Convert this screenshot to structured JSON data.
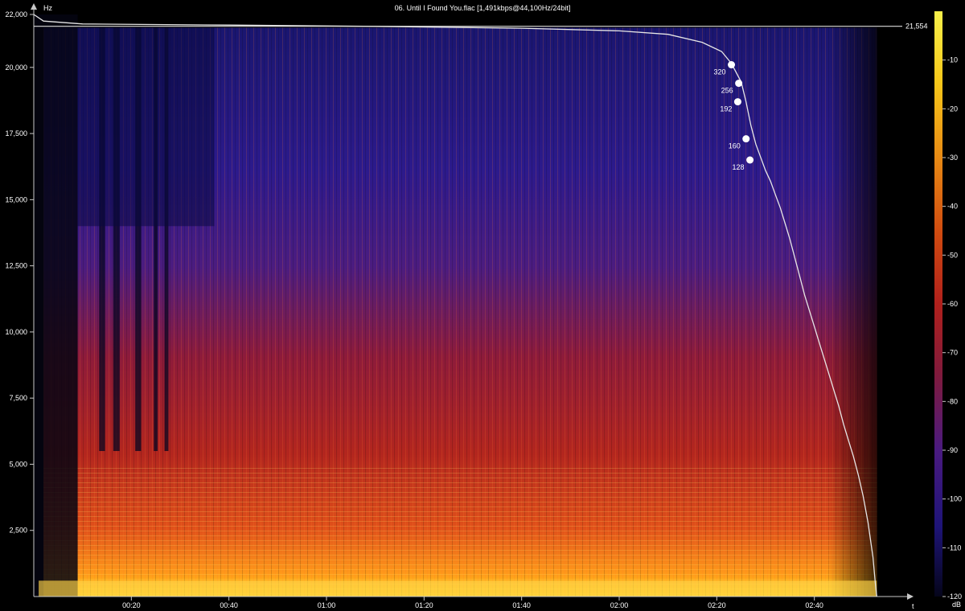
{
  "title": "06. Until I Found You.flac [1,491kbps@44,100Hz/24bit]",
  "colors": {
    "background": "#000000",
    "axis": "#c8c8c8",
    "curve": "#e6e6e6",
    "marker": "#ffffff"
  },
  "chart_data": {
    "type": "heatmap",
    "title": "06. Until I Found You.flac [1,491kbps@44,100Hz/24bit]",
    "y_unit": "Hz",
    "x_unit": "t",
    "colorbar_unit": "dB",
    "duration_s": 177,
    "ylim": [
      0,
      22000
    ],
    "y_ticks": [
      {
        "value": 2500,
        "label": "2,500"
      },
      {
        "value": 5000,
        "label": "5,000"
      },
      {
        "value": 7500,
        "label": "7,500"
      },
      {
        "value": 10000,
        "label": "10,000"
      },
      {
        "value": 12500,
        "label": "12,500"
      },
      {
        "value": 15000,
        "label": "15,000"
      },
      {
        "value": 17500,
        "label": "17,500"
      },
      {
        "value": 20000,
        "label": "20,000"
      },
      {
        "value": 22000,
        "label": "22,000"
      }
    ],
    "x_ticks": [
      {
        "value": 20,
        "label": "00:20"
      },
      {
        "value": 40,
        "label": "00:40"
      },
      {
        "value": 60,
        "label": "01:00"
      },
      {
        "value": 80,
        "label": "01:20"
      },
      {
        "value": 100,
        "label": "01:40"
      },
      {
        "value": 120,
        "label": "02:00"
      },
      {
        "value": 140,
        "label": "02:20"
      },
      {
        "value": 160,
        "label": "02:40"
      }
    ],
    "colorbar_range": [
      -120,
      0
    ],
    "colorbar_ticks": [
      {
        "value": -10,
        "label": "-10"
      },
      {
        "value": -20,
        "label": "-20"
      },
      {
        "value": -30,
        "label": "-30"
      },
      {
        "value": -40,
        "label": "-40"
      },
      {
        "value": -50,
        "label": "-50"
      },
      {
        "value": -60,
        "label": "-60"
      },
      {
        "value": -70,
        "label": "-70"
      },
      {
        "value": -80,
        "label": "-80"
      },
      {
        "value": -90,
        "label": "-90"
      },
      {
        "value": -100,
        "label": "-100"
      },
      {
        "value": -110,
        "label": "-110"
      },
      {
        "value": -120,
        "label": "-120"
      }
    ],
    "cutoff_line": {
      "value": 21554,
      "label": "21,554"
    },
    "cutoff_curve": [
      [
        0,
        22000
      ],
      [
        2,
        21750
      ],
      [
        10,
        21640
      ],
      [
        40,
        21600
      ],
      [
        70,
        21550
      ],
      [
        100,
        21480
      ],
      [
        120,
        21380
      ],
      [
        130,
        21250
      ],
      [
        137,
        20950
      ],
      [
        141,
        20600
      ],
      [
        143,
        20150
      ],
      [
        145,
        19450
      ],
      [
        146,
        18700
      ],
      [
        147,
        17800
      ],
      [
        148,
        17100
      ],
      [
        149,
        16600
      ],
      [
        150,
        16100
      ],
      [
        151,
        15700
      ],
      [
        152,
        15200
      ],
      [
        153,
        14700
      ],
      [
        154,
        14100
      ],
      [
        155,
        13500
      ],
      [
        156,
        12800
      ],
      [
        157,
        12100
      ],
      [
        158,
        11400
      ],
      [
        159,
        10800
      ],
      [
        160,
        10200
      ],
      [
        161,
        9600
      ],
      [
        162,
        9000
      ],
      [
        163,
        8400
      ],
      [
        164,
        7800
      ],
      [
        165,
        7200
      ],
      [
        166,
        6500
      ],
      [
        167,
        5900
      ],
      [
        168,
        5300
      ],
      [
        169,
        4600
      ],
      [
        170,
        3800
      ],
      [
        171,
        2800
      ],
      [
        172,
        1500
      ],
      [
        172.5,
        500
      ],
      [
        172.8,
        0
      ]
    ],
    "bitrate_markers": [
      {
        "label": "320",
        "t": 143,
        "hz": 20100
      },
      {
        "label": "256",
        "t": 144.5,
        "hz": 19400
      },
      {
        "label": "192",
        "t": 144.3,
        "hz": 18700
      },
      {
        "label": "160",
        "t": 146,
        "hz": 17300
      },
      {
        "label": "128",
        "t": 146.8,
        "hz": 16500
      }
    ]
  }
}
